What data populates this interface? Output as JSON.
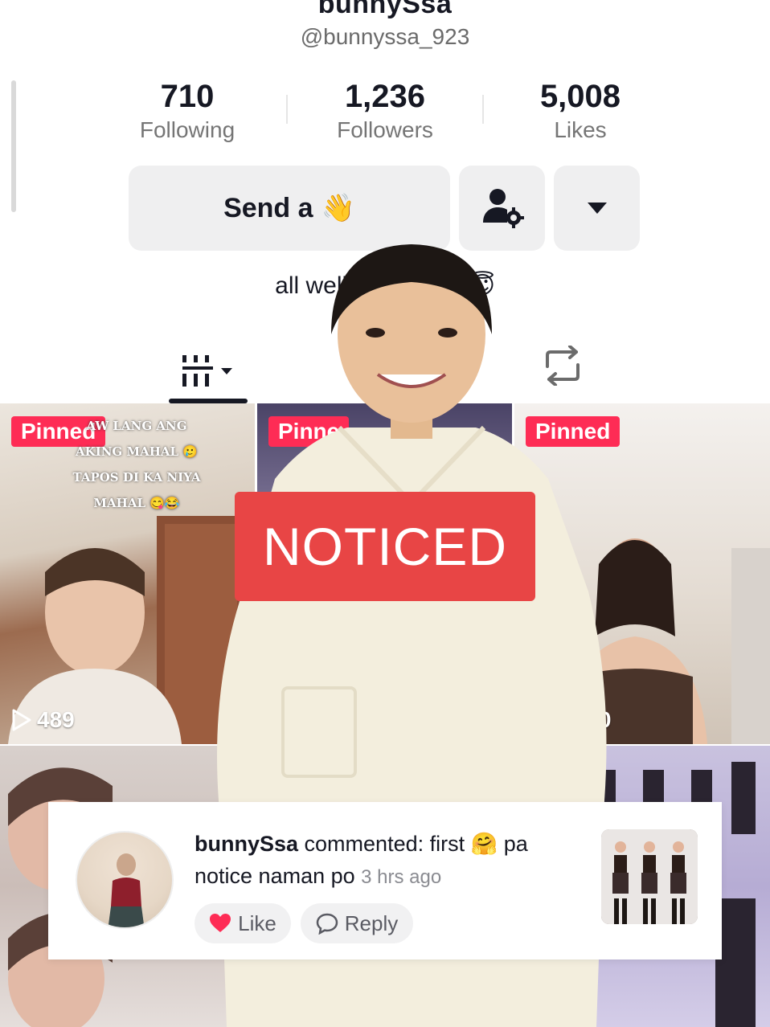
{
  "profile": {
    "display_name": "bunnySsa",
    "handle": "@bunnyssa_923",
    "bio": "all well be           time 🙏😇"
  },
  "stats": [
    {
      "value": "710",
      "label": "Following"
    },
    {
      "value": "1,236",
      "label": "Followers"
    },
    {
      "value": "5,008",
      "label": "Likes"
    }
  ],
  "actions": {
    "send_label": "Send a",
    "send_emoji": "👋",
    "user_settings_icon": "person-gear-icon",
    "more_icon": "caret-down-icon"
  },
  "tabs": {
    "videos_icon": "grid-sort-icon",
    "reposts_icon": "repost-icon"
  },
  "grid": {
    "pinned_label": "Pinned",
    "pinned_label_partial": "Pinne",
    "tile1_overlay_lines": [
      "AW LANG ANG",
      "AKING MAHAL 🥲",
      "TAPOS DI KA NIYA",
      "MAHAL 😋😂"
    ],
    "tile1_views": "489",
    "tile3_views": ",650"
  },
  "sticker": {
    "text": "NOTICED"
  },
  "comment": {
    "user": "bunnySsa",
    "text": " commented: first 🤗 pa notice naman po ",
    "time": "3 hrs ago",
    "like_label": "Like",
    "reply_label": "Reply"
  },
  "colors": {
    "accent_red": "#fe2c55",
    "sticker_red": "#e84545",
    "text_dark": "#161823",
    "text_gray": "#757575"
  }
}
